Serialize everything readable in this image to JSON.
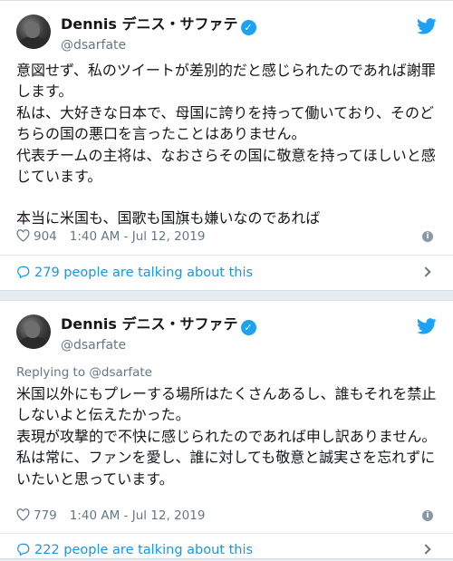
{
  "tweets": [
    {
      "author": {
        "display_name": "Dennis デニス・サファテ",
        "handle": "@dsarfate",
        "verified": true
      },
      "replying_to": null,
      "paragraphs": [
        "意図せず、私のツイートが差別的だと感じられたのであれば謝罪します。",
        "私は、大好きな日本で、母国に誇りを持って働いており、そのどちらの国の悪口を言ったことはありません。",
        "代表チームの主将は、なおさらその国に敬意を持ってほしいと感じています。",
        "",
        "本当に米国も、国歌も国旗も嫌いなのであれば"
      ],
      "likes": "904",
      "timestamp": "1:40 AM - Jul 12, 2019",
      "talking": "279 people are talking about this"
    },
    {
      "author": {
        "display_name": "Dennis デニス・サファテ",
        "handle": "@dsarfate",
        "verified": true
      },
      "replying_to": "Replying to @dsarfate",
      "paragraphs": [
        "米国以外にもプレーする場所はたくさんあるし、誰もそれを禁止しないよと伝えたかった。",
        "表現が攻撃的で不快に感じられたのであれば申し訳ありません。",
        "私は常に、ファンを愛し、誰に対しても敬意と誠実さを忘れずにいたいと思っています。"
      ],
      "likes": "779",
      "timestamp": "1:40 AM - Jul 12, 2019",
      "talking": "222 people are talking about this"
    }
  ],
  "colors": {
    "accent": "#1da1f2",
    "link": "#1b95e0",
    "muted": "#657786",
    "background": "#e6ecf0"
  },
  "icons": {
    "verified": "verified-badge-icon",
    "logo": "twitter-bird-icon",
    "like": "heart-icon",
    "info": "info-icon",
    "reply": "speech-bubble-icon",
    "more": "chevron-right-icon"
  }
}
